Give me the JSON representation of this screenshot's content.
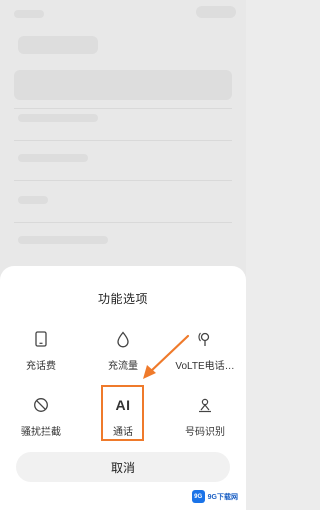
{
  "sheet": {
    "title": "功能选项",
    "options": [
      {
        "label": "充话费",
        "icon": "phone-icon"
      },
      {
        "label": "充流量",
        "icon": "drop-icon"
      },
      {
        "label": "VoLTE电话…",
        "icon": "volte-icon"
      },
      {
        "label": "骚扰拦截",
        "icon": "block-icon"
      },
      {
        "label": "通话",
        "icon": "ai-icon",
        "glyph": "AI",
        "highlighted": true
      },
      {
        "label": "号码识别",
        "icon": "number-recognition-icon"
      }
    ],
    "cancel_label": "取消"
  },
  "accent_color": "#ef7a2b",
  "watermark": {
    "logo_text": "9G",
    "text": "9G下载网"
  }
}
